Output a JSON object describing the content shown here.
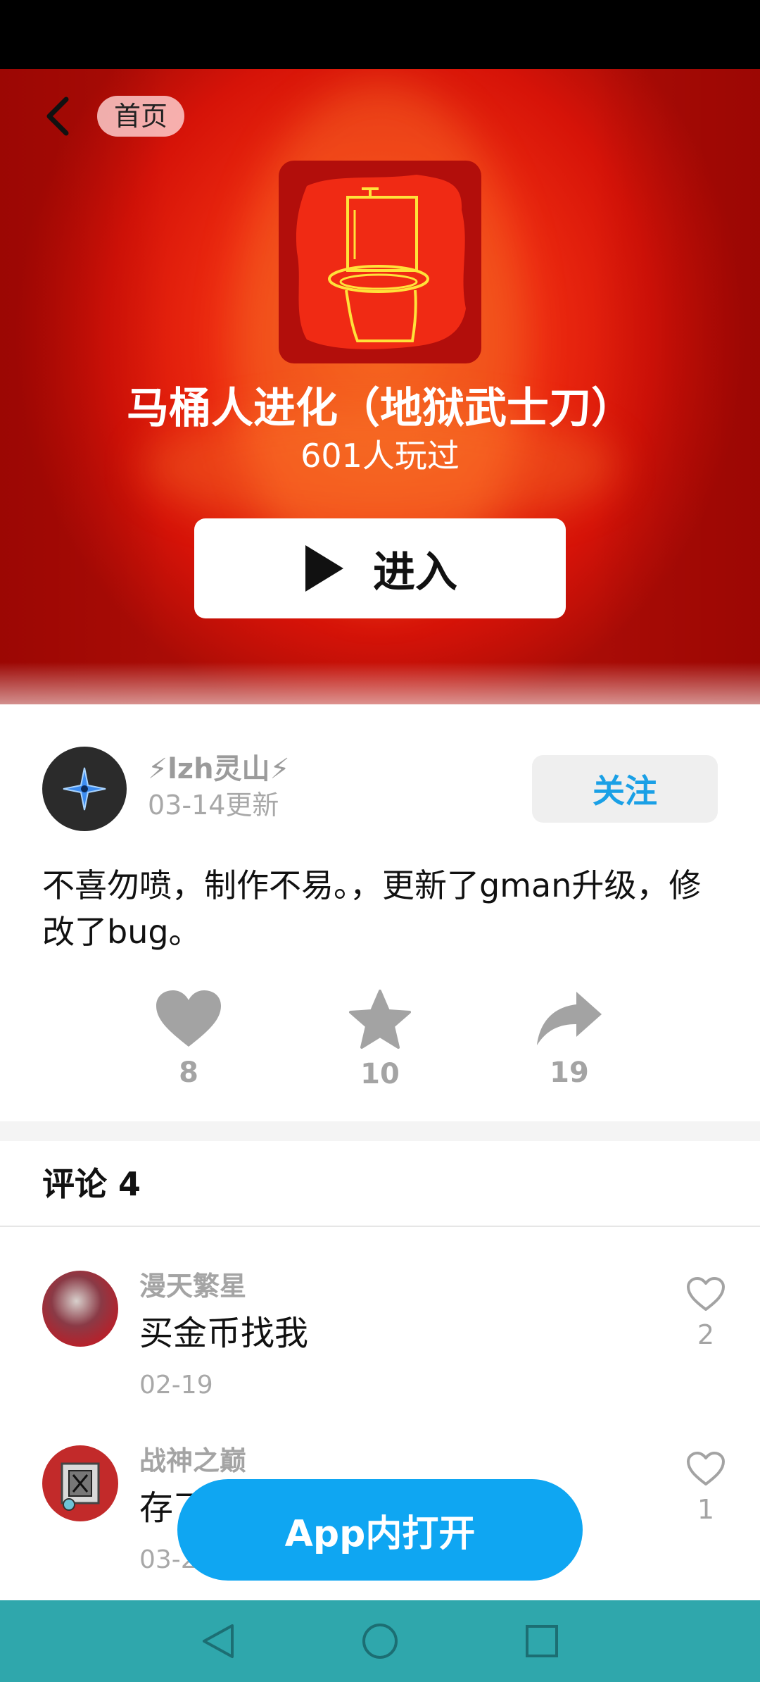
{
  "header": {
    "home_label": "首页"
  },
  "game": {
    "title": "马桶人进化（地狱武士刀）",
    "play_count": "601人玩过",
    "enter_label": "进入"
  },
  "author": {
    "name": "⚡lzh灵山⚡",
    "updated": "03-14更新",
    "follow_label": "关注"
  },
  "description": "不喜勿喷，制作不易。，更新了gman升级，修改了bug。",
  "actions": {
    "likes": "8",
    "favorites": "10",
    "shares": "19"
  },
  "comments": {
    "title": "评论 4",
    "items": [
      {
        "user": "漫天繁星",
        "text": "买金币找我",
        "date": "02-19",
        "likes": "2"
      },
      {
        "user": "战神之巅",
        "text": "存了",
        "date": "03-2",
        "likes": "1"
      }
    ]
  },
  "open_app_label": "App内打开",
  "colors": {
    "accent_blue": "#0fa6f2",
    "follow_text": "#1aa0e6",
    "hero_red": "#e61c0c",
    "nav_bar": "#2fa7ac"
  }
}
